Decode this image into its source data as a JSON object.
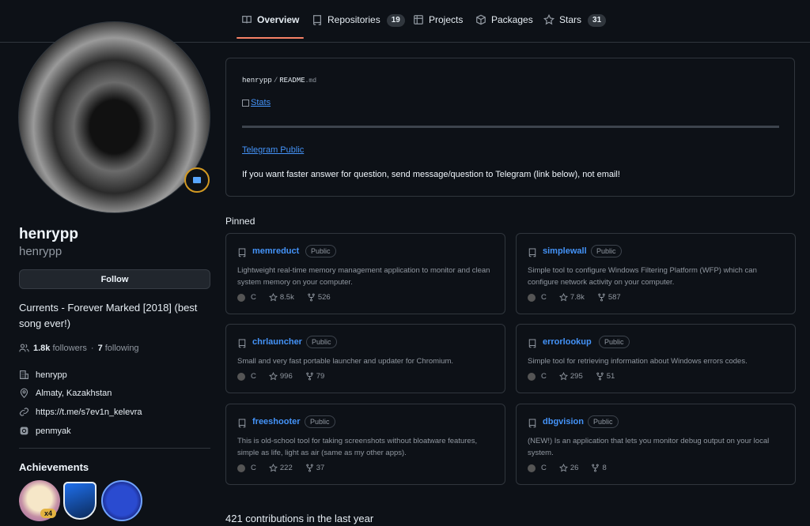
{
  "nav": {
    "tabs": [
      {
        "label": "Overview",
        "count": null
      },
      {
        "label": "Repositories",
        "count": "19"
      },
      {
        "label": "Projects",
        "count": null
      },
      {
        "label": "Packages",
        "count": null
      },
      {
        "label": "Stars",
        "count": "31"
      }
    ]
  },
  "profile": {
    "name": "henrypp",
    "login": "henrypp",
    "follow_label": "Follow",
    "bio": "Currents - Forever Marked [2018] (best song ever!)",
    "followers_count": "1.8k",
    "followers_label": "followers",
    "separator": "·",
    "following_count": "7",
    "following_label": "following",
    "organization": "henrypp",
    "location": "Almaty, Kazakhstan",
    "website": "https://t.me/s7ev1n_kelevra",
    "social": "penmyak"
  },
  "achievements": {
    "title": "Achievements",
    "first_badge_multiplier": "x4"
  },
  "readme": {
    "owner": "henrypp",
    "separator": "/",
    "file": "README",
    "ext": ".md",
    "stats_alt": "Stats",
    "telegram_link": "Telegram Public",
    "message": "If you want faster answer for question, send message/question to Telegram (link below), not email!"
  },
  "pinned": {
    "title": "Pinned",
    "repos": [
      {
        "name": "memreduct",
        "visibility": "Public",
        "desc": "Lightweight real-time memory management application to monitor and clean system memory on your computer.",
        "lang": "C",
        "stars": "8.5k",
        "forks": "526"
      },
      {
        "name": "simplewall",
        "visibility": "Public",
        "desc": "Simple tool to configure Windows Filtering Platform (WFP) which can configure network activity on your computer.",
        "lang": "C",
        "stars": "7.8k",
        "forks": "587"
      },
      {
        "name": "chrlauncher",
        "visibility": "Public",
        "desc": "Small and very fast portable launcher and updater for Chromium.",
        "lang": "C",
        "stars": "996",
        "forks": "79"
      },
      {
        "name": "errorlookup",
        "visibility": "Public",
        "desc": "Simple tool for retrieving information about Windows errors codes.",
        "lang": "C",
        "stars": "295",
        "forks": "51"
      },
      {
        "name": "freeshooter",
        "visibility": "Public",
        "desc": "This is old-school tool for taking screenshots without bloatware features, simple as life, light as air (same as my other apps).",
        "lang": "C",
        "stars": "222",
        "forks": "37"
      },
      {
        "name": "dbgvision",
        "visibility": "Public",
        "desc": "(NEW!) Is an application that lets you monitor debug output on your local system.",
        "lang": "C",
        "stars": "26",
        "forks": "8"
      }
    ]
  },
  "contributions": {
    "title": "421 contributions in the last year"
  },
  "colors": {
    "background": "#0d1117",
    "accent_underline": "#f78166",
    "link": "#4493f8",
    "lang_c": "#555555"
  }
}
